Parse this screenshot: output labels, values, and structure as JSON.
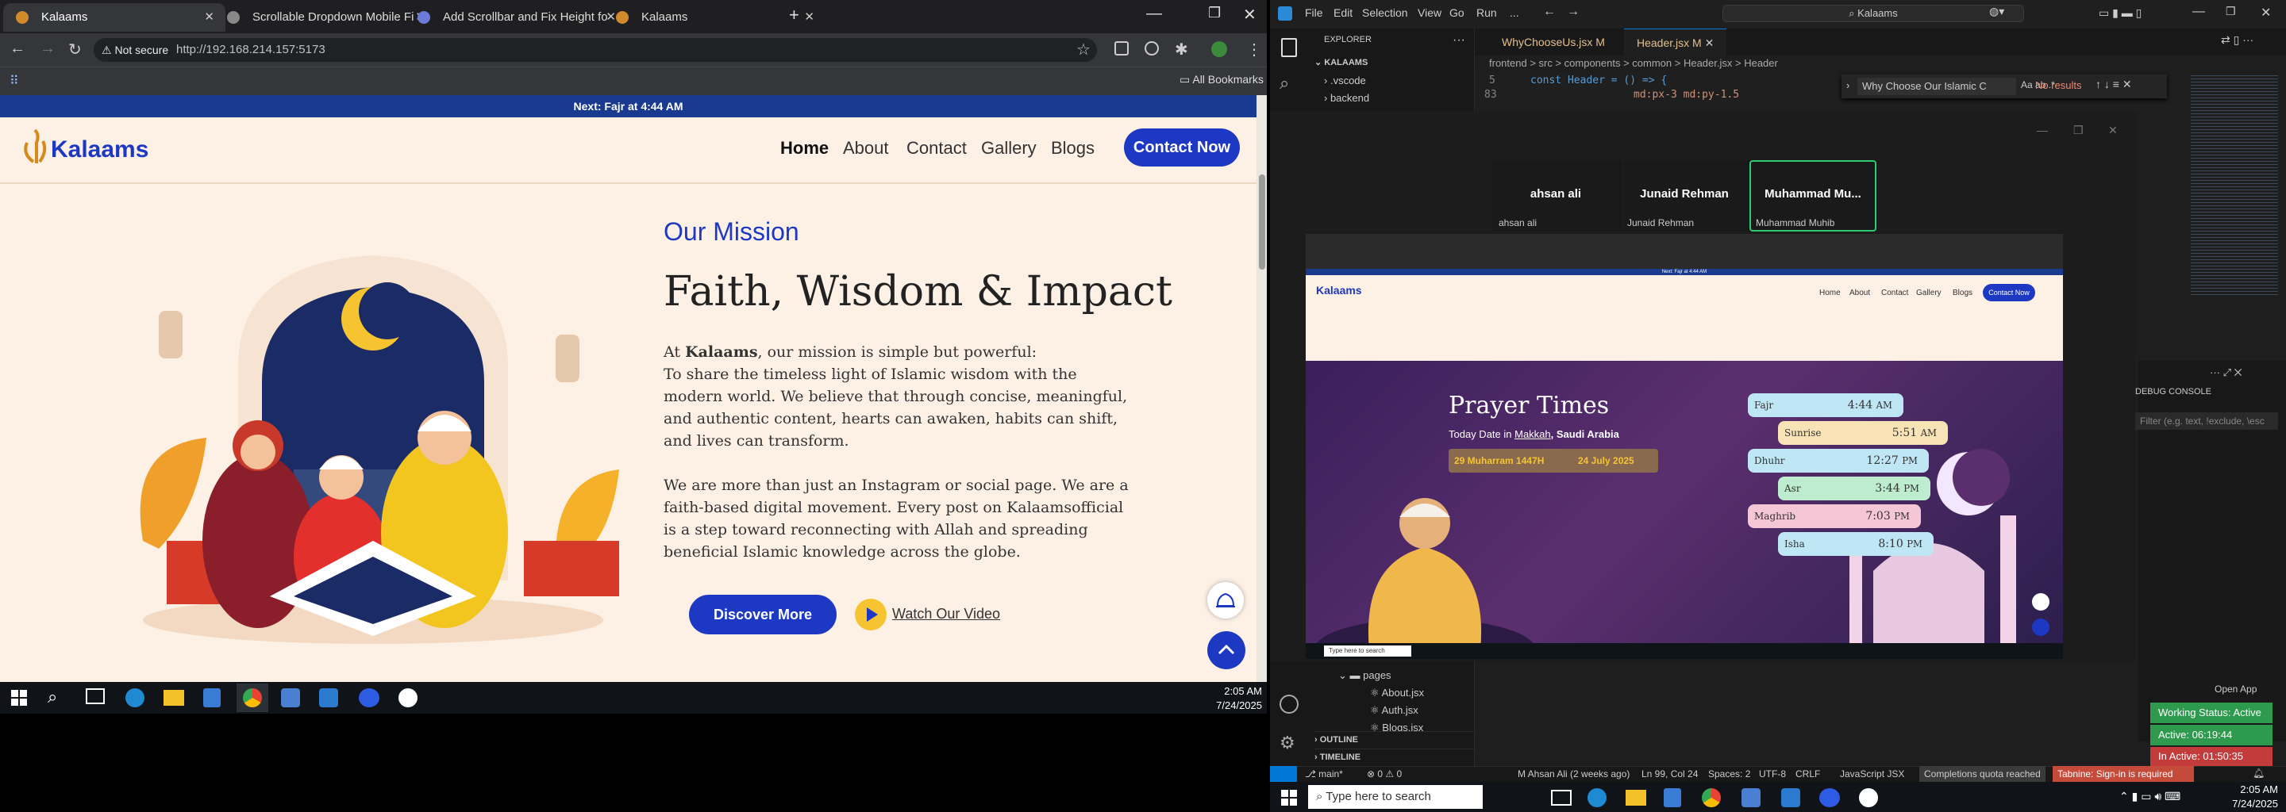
{
  "chrome": {
    "tabs": [
      {
        "title": "Kalaams",
        "active": true
      },
      {
        "title": "Scrollable Dropdown Mobile Fi",
        "active": false
      },
      {
        "title": "Add Scrollbar and Fix Height fo",
        "active": false
      },
      {
        "title": "Kalaams",
        "active": false
      }
    ],
    "not_secure": "Not secure",
    "url": "http://192.168.214.157:5173",
    "all_bookmarks": "All Bookmarks"
  },
  "site": {
    "notice": "Next: Fajr at 4:44 AM",
    "logo": "Kalaams",
    "nav": [
      "Home",
      "About",
      "Contact",
      "Gallery",
      "Blogs"
    ],
    "contact_btn": "Contact Now",
    "mission": {
      "eyebrow": "Our Mission",
      "title": "Faith, Wisdom & Impact",
      "p1_prefix": "At ",
      "p1_brand": "Kalaams",
      "p1_rest": ", our mission is simple but powerful:",
      "p1_body": "To share the timeless light of Islamic wisdom with the modern world. We believe that through concise, meaningful, and authentic content, hearts can awaken, habits can shift, and lives can transform.",
      "p2": "We are more than just an Instagram or social page. We are a faith-based digital movement. Every post on Kalaamsofficial is a step toward reconnecting with Allah and spreading beneficial Islamic knowledge across the globe.",
      "discover": "Discover More",
      "watch": "Watch Our Video"
    }
  },
  "left_taskbar": {
    "time": "2:05 AM",
    "date": "7/24/2025"
  },
  "vscode": {
    "menu": [
      "File",
      "Edit",
      "Selection",
      "View",
      "Go",
      "Run",
      "..."
    ],
    "search": "Kalaams",
    "explorer_title": "EXPLORER",
    "project": "KALAAMS",
    "tree": [
      ".vscode",
      "backend"
    ],
    "tree_bottom": [
      "pages",
      "About.jsx",
      "Auth.jsx",
      "Blogs.jsx"
    ],
    "sections": [
      "OUTLINE",
      "TIMELINE"
    ],
    "tabs": [
      {
        "title": "WhyChooseUs.jsx M",
        "active": false
      },
      {
        "title": "Header.jsx M",
        "active": true
      }
    ],
    "breadcrumb": "frontend > src > components > common > Header.jsx > Header",
    "code_line_no": "5",
    "code_line": "const Header = () => {",
    "code_line2_no": "83",
    "code_line2": "md:px-3 md:py-1.5",
    "find_text": "Why Choose Our Islamic C",
    "find_result": "No results",
    "debug_console": "DEBUG CONSOLE",
    "filter_placeholder": "Filter (e.g. text, !exclude, \\esc",
    "open_app": "Open App",
    "working_status": "Working Status: Active",
    "active_time": "Active: 06:19:44",
    "inactive_time": "In Active: 01:50:35",
    "status": {
      "branch": "main*",
      "problems": "0 ⚠ 0",
      "author": "M Ahsan Ali (2 weeks ago)",
      "position": "Ln 99, Col 24",
      "spaces": "Spaces: 2",
      "encoding": "UTF-8",
      "eol": "CRLF",
      "language": "JavaScript JSX",
      "quota": "Completions quota reached",
      "tabnine": "Tabnine: Sign-in is required"
    }
  },
  "viewer": {
    "cards": [
      {
        "name": "ahsan ali",
        "sub": "ahsan ali"
      },
      {
        "name": "Junaid Rehman",
        "sub": "Junaid Rehman"
      },
      {
        "name": "Muhammad  Mu...",
        "sub": "Muhammad Muhib"
      }
    ],
    "shot_notice": "Next: Fajr at 4:44 AM",
    "shot_nav": [
      "Home",
      "About",
      "Contact",
      "Gallery",
      "Blogs"
    ],
    "shot_contact": "Contact Now",
    "prayer_title": "Prayer Times",
    "today_prefix": "Today Date in ",
    "today_city": "Makkah",
    "today_country": ", Saudi Arabia",
    "hijri": "29 Muharram 1447H",
    "gregorian": "24 July 2025",
    "prayers": [
      {
        "name": "Fajr",
        "time": "4:44",
        "ampm": "AM",
        "color": "#bfe6f5"
      },
      {
        "name": "Sunrise",
        "time": "5:51",
        "ampm": "AM",
        "color": "#f7e3b5"
      },
      {
        "name": "Dhuhr",
        "time": "12:27",
        "ampm": "PM",
        "color": "#bfe6f5"
      },
      {
        "name": "Asr",
        "time": "3:44",
        "ampm": "PM",
        "color": "#bdeccf"
      },
      {
        "name": "Maghrib",
        "time": "7:03",
        "ampm": "PM",
        "color": "#f5c6d6"
      },
      {
        "name": "Isha",
        "time": "8:10",
        "ampm": "PM",
        "color": "#bfe6f5"
      }
    ],
    "shot_search": "Type here to search"
  },
  "right_taskbar": {
    "search": "Type here to search",
    "time": "2:05 AM",
    "date": "7/24/2025"
  }
}
